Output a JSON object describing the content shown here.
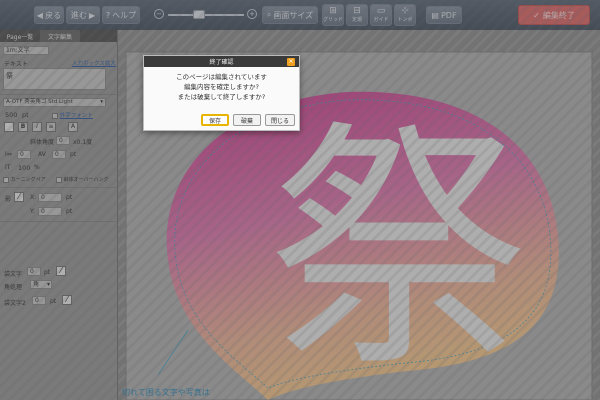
{
  "toolbar": {
    "back_label": "戻る",
    "forward_label": "進む",
    "help_label": "ヘルプ",
    "zoom_label": "画面サイズ",
    "zoom_level": 0.4,
    "tools": [
      {
        "name": "grid",
        "label": "グリッド",
        "glyph": "⊞"
      },
      {
        "name": "guideline",
        "label": "定規",
        "glyph": "⊟"
      },
      {
        "name": "guide",
        "label": "ガイド",
        "glyph": "▭"
      },
      {
        "name": "trim",
        "label": "トンボ",
        "glyph": "⊹"
      }
    ],
    "pdf_label": "PDF",
    "finish_label": "編集終了"
  },
  "panel": {
    "tabs": [
      "Page一覧",
      "文字編集"
    ],
    "layer_label": "1m:文字",
    "text_heading": "テキスト",
    "input_box_link": "入力ボックス拡大",
    "text_value": "祭",
    "font_name": "A-OTF 秀英角ゴ Std Light",
    "font_size": "500",
    "font_unit": "pt",
    "outline_font_link": "外字フォント",
    "format_buttons": [
      "B",
      "I",
      "≡",
      "A"
    ],
    "slant_label": "斜体角度",
    "slant_value": "0",
    "slant_unit": "x0.1度",
    "tracking_value": "0",
    "kerning_value": "0",
    "kerning_unit": "pt",
    "scale_value": "100",
    "scale_unit": "%",
    "kerning_pair_label": "カーニングペア",
    "overhang_label": "斜体オーバーハング",
    "shadow_label": "影",
    "shadow_x_label": "X:",
    "shadow_x": "0",
    "shadow_y_label": "Y:",
    "shadow_y": "0",
    "outline1_label": "袋文字",
    "outline1_value": "0",
    "corner_label": "角処理",
    "corner_value": "角",
    "outline2_label": "袋文字2",
    "outline2_value": "0"
  },
  "canvas": {
    "artwork_char": "祭",
    "warning_text": "切れて困る文字や写真は"
  },
  "dialog": {
    "title": "終了確認",
    "message_lines": [
      "このページは編集されています",
      "編集内容を確定しますか?",
      "または破棄して終了しますか?"
    ],
    "save_label": "保存",
    "discard_label": "破棄",
    "close_label": "閉じる"
  },
  "colors": {
    "accent": "#e8b400",
    "finish": "#e06c6c",
    "fan_top": "#d64e9c",
    "fan_bottom": "#f3b98f",
    "link": "#2f5fa8"
  }
}
